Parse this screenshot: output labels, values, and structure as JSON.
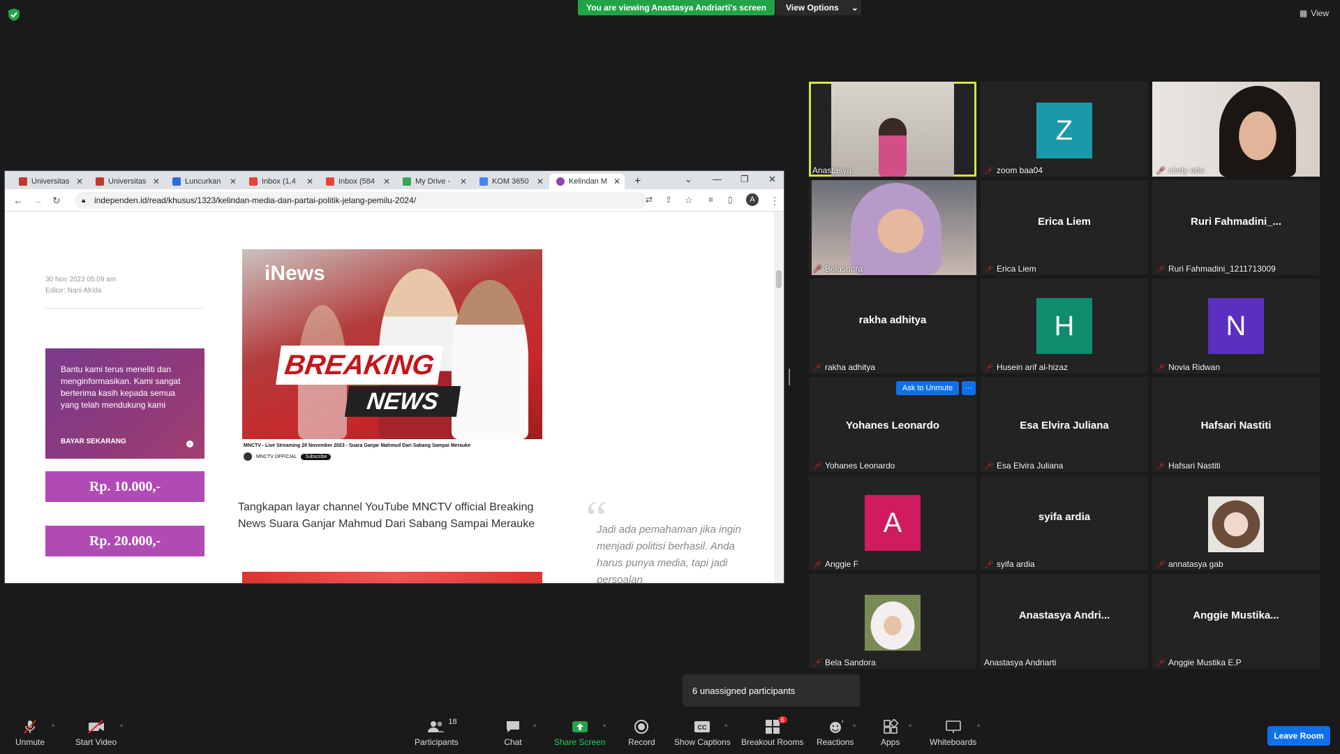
{
  "top": {
    "banner": "You are viewing Anastasya Andriarti's screen",
    "view_options": "View Options",
    "view": "View"
  },
  "browser": {
    "tabs": [
      {
        "label": "Universitas",
        "color": "#c0392b"
      },
      {
        "label": "Universitas",
        "color": "#c0392b"
      },
      {
        "label": "Luncurkan",
        "color": "#2d6cdf"
      },
      {
        "label": "Inbox (1,4",
        "color": "#ea4335"
      },
      {
        "label": "Inbox (584",
        "color": "#ea4335"
      },
      {
        "label": "My Drive -",
        "color": "#34a853"
      },
      {
        "label": "KOM 3650",
        "color": "#4285f4"
      },
      {
        "label": "Kelindan M",
        "color": "#8e44ad"
      }
    ],
    "url": "independen.id/read/khusus/1323/kelindan-media-dan-partai-politik-jelang-pemilu-2024/",
    "profile_initial": "A"
  },
  "article": {
    "date": "30 Nov 2023 05:09 am",
    "editor": "Editor: Nani Afrida",
    "support_text": "Bantu kami terus meneliti dan menginformasikan. Kami sangat berterima kasih kepada semua yang telah mendukung kami",
    "pay_now": "BAYAR SEKARANG",
    "amounts": [
      "Rp. 10.000,-",
      "Rp. 20.000,-"
    ],
    "image_brand": "iNews",
    "image_breaking": "BREAKING",
    "image_news": "NEWS",
    "yt_title": "MNCTV - Live Streaming 28 November 2023 - Suara Ganjar Mahmud Dari Sabang Sampai Merauke",
    "yt_channel": "MNCTV OFFICIAL",
    "yt_subscribe": "Subscribe",
    "caption": "Tangkapan layar channel YouTube MNCTV official Breaking News Suara Ganjar Mahmud Dari Sabang Sampai Merauke",
    "quote": "Jadi ada pemahaman jika ingin menjadi politisi berhasil. Anda harus punya media, tapi jadi persoalan"
  },
  "participants": [
    {
      "name": "Anastasya",
      "type": "photo",
      "muted": false,
      "active": true
    },
    {
      "name": "zoom baa04",
      "type": "avatar",
      "initial": "Z",
      "color": "#1a9aa9",
      "muted": true
    },
    {
      "name": "cindy otto",
      "type": "photo",
      "muted": true
    },
    {
      "name": "Belasndra",
      "type": "photo",
      "muted": true
    },
    {
      "name": "Erica Liem",
      "type": "text",
      "display": "Erica Liem",
      "muted": true
    },
    {
      "name": "Ruri Fahmadini_1211713009",
      "type": "text",
      "display": "Ruri  Fahmadini_...",
      "muted": true
    },
    {
      "name": "rakha adhitya",
      "type": "text",
      "display": "rakha adhitya",
      "muted": true
    },
    {
      "name": "Husein arif al-hizaz",
      "type": "avatar",
      "initial": "H",
      "color": "#0f8b6e",
      "muted": true
    },
    {
      "name": "Novia Ridwan",
      "type": "avatar",
      "initial": "N",
      "color": "#5a2fc1",
      "muted": true
    },
    {
      "name": "Yohanes Leonardo",
      "type": "text",
      "display": "Yohanes Leonardo",
      "muted": true
    },
    {
      "name": "Esa Elvira Juliana",
      "type": "text",
      "display": "Esa Elvira Juliana",
      "muted": true
    },
    {
      "name": "Hafsari Nastiti",
      "type": "text",
      "display": "Hafsari Nastiti",
      "muted": true
    },
    {
      "name": "Anggie F",
      "type": "avatar",
      "initial": "A",
      "color": "#d01b5e",
      "muted": true
    },
    {
      "name": "syifa ardia",
      "type": "text",
      "display": "syifa ardia",
      "muted": true
    },
    {
      "name": "annatasya gab",
      "type": "photo",
      "muted": true
    },
    {
      "name": "Bela Sandora",
      "type": "photo",
      "muted": true
    },
    {
      "name": "Anastasya Andriarti",
      "type": "text",
      "display": "Anastasya  Andri...",
      "muted": false
    },
    {
      "name": "Anggie Mustika E.P",
      "type": "text",
      "display": "Anggie  Mustika...",
      "muted": true
    }
  ],
  "ask_to_unmute": "Ask to Unmute",
  "unassigned": "6 unassigned participants",
  "toolbar": {
    "unmute": "Unmute",
    "start_video": "Start Video",
    "participants": "Participants",
    "participants_count": "18",
    "chat": "Chat",
    "share_screen": "Share Screen",
    "record": "Record",
    "show_captions": "Show Captions",
    "breakout_rooms": "Breakout Rooms",
    "breakout_badge": "6",
    "reactions": "Reactions",
    "apps": "Apps",
    "whiteboards": "Whiteboards",
    "leave_room": "Leave Room"
  },
  "colors": {
    "share_green": "#23a347",
    "zoom_blue": "#0e71eb",
    "active_speaker": "#d7e543",
    "muted_red": "#e03b3b"
  }
}
